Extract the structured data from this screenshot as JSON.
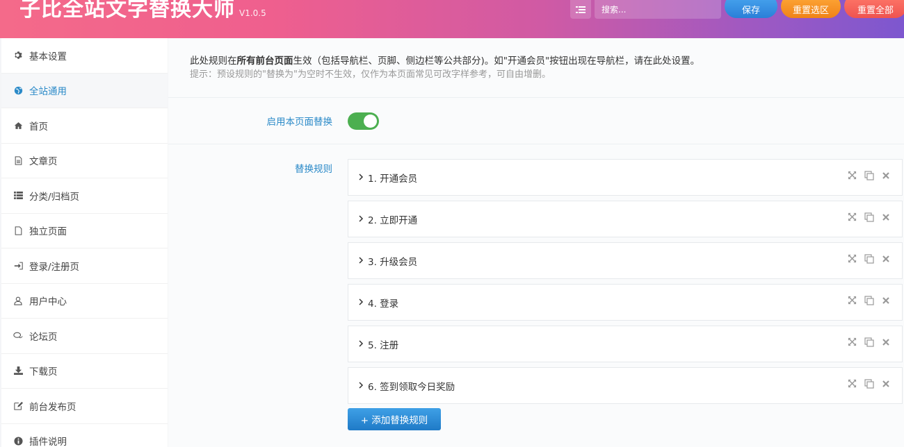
{
  "header": {
    "title": "子比全站文字替换大师",
    "version": "V1.0.5",
    "search_placeholder": "搜索...",
    "save_label": "保存",
    "reset_section_label": "重置选区",
    "reset_all_label": "重置全部"
  },
  "sidebar": {
    "items": [
      {
        "label": "基本设置",
        "icon": "gear-icon"
      },
      {
        "label": "全站通用",
        "icon": "globe-icon"
      },
      {
        "label": "首页",
        "icon": "home-icon"
      },
      {
        "label": "文章页",
        "icon": "document-icon"
      },
      {
        "label": "分类/归档页",
        "icon": "list-icon"
      },
      {
        "label": "独立页面",
        "icon": "file-icon"
      },
      {
        "label": "登录/注册页",
        "icon": "sign-in-icon"
      },
      {
        "label": "用户中心",
        "icon": "user-icon"
      },
      {
        "label": "论坛页",
        "icon": "comments-icon"
      },
      {
        "label": "下载页",
        "icon": "download-icon"
      },
      {
        "label": "前台发布页",
        "icon": "edit-icon"
      },
      {
        "label": "插件说明",
        "icon": "info-icon"
      }
    ],
    "active_index": 1
  },
  "main": {
    "notice_prefix": "此处规则在",
    "notice_bold": "所有前台页面",
    "notice_suffix": "生效（包括导航栏、页脚、侧边栏等公共部分)。如\"开通会员\"按钮出现在导航栏，请在此处设置。",
    "notice_hint": "提示：预设规则的\"替换为\"为空时不生效，仅作为本页面常见可改字样参考，可自由增删。",
    "toggle_label": "启用本页面替换",
    "toggle_on": true,
    "rules_label": "替换规则",
    "rules": [
      {
        "title": "1. 开通会员"
      },
      {
        "title": "2. 立即开通"
      },
      {
        "title": "3. 升级会员"
      },
      {
        "title": "4. 登录"
      },
      {
        "title": "5. 注册"
      },
      {
        "title": "6. 签到领取今日奖励"
      }
    ],
    "add_rule_label": "+ 添加替换规则"
  },
  "colors": {
    "accent": "#2b8ac8",
    "toggle_on": "#4caf50",
    "save": "#2a7fd8",
    "reset_section": "#f08218",
    "reset_all": "#ef5350"
  }
}
